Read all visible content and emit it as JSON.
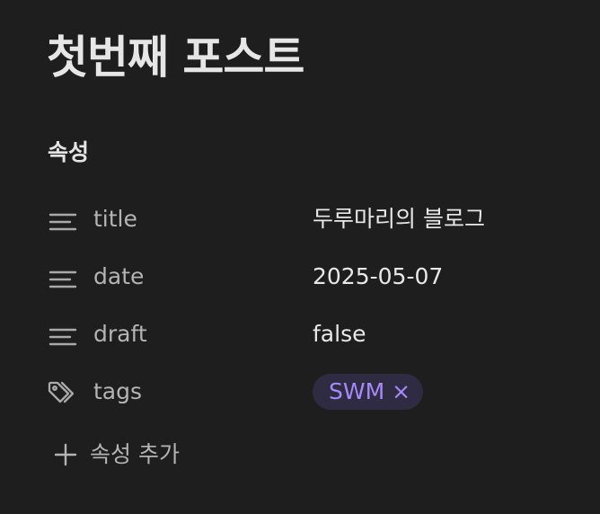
{
  "page": {
    "title": "첫번째 포스트"
  },
  "properties": {
    "heading": "속성",
    "items": [
      {
        "icon": "text-lines-icon",
        "key": "title",
        "value": "두루마리의 블로그"
      },
      {
        "icon": "text-lines-icon",
        "key": "date",
        "value": "2025-05-07"
      },
      {
        "icon": "text-lines-icon",
        "key": "draft",
        "value": "false"
      },
      {
        "icon": "tags-icon",
        "key": "tags",
        "tags": [
          {
            "label": "SWM",
            "remove_glyph": "×"
          }
        ]
      }
    ],
    "add_label": "속성 추가",
    "add_icon": "plus-icon"
  },
  "colors": {
    "background": "#1e1e1e",
    "tag_background": "#2f2b42",
    "tag_text": "#a68af9"
  }
}
